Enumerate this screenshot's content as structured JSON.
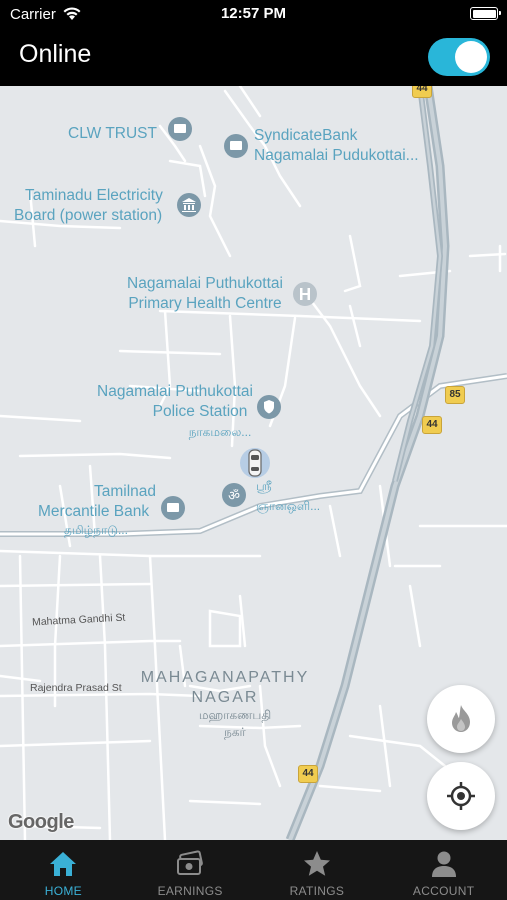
{
  "status_bar": {
    "carrier": "Carrier",
    "time": "12:57 PM"
  },
  "header": {
    "title": "Online",
    "online_toggle": true
  },
  "map": {
    "places": [
      {
        "name": "CLW TRUST"
      },
      {
        "name": "SyndicateBank",
        "sub": "Nagamalai Pudukottai..."
      },
      {
        "name": "Taminadu Electricity",
        "sub": "Board (power station)"
      },
      {
        "name": "Nagamalai Puthukottai",
        "sub": "Primary Health Centre"
      },
      {
        "name": "Nagamalai Puthukottai",
        "sub": "Police Station",
        "tamil": "நாகமலை..."
      },
      {
        "name": "Tamilnad",
        "sub": "Mercantile Bank",
        "tamil": "தமிழ்நாடு..."
      },
      {
        "tamil": "ஸ்ரீ",
        "tamil2": "ஞானஒளி..."
      }
    ],
    "streets": [
      "Mahatma Gandhi St",
      "Rajendra Prasad St"
    ],
    "area": {
      "name_line1": "MAHAGANAPATHY",
      "name_line2": "NAGAR",
      "tamil_line1": "மஹாகணபதி",
      "tamil_line2": "நகர்"
    },
    "highway_shields": [
      "44",
      "85",
      "44",
      "44"
    ],
    "attribution": "Google"
  },
  "fabs": {
    "surge": "flame-icon",
    "locate": "crosshair-icon"
  },
  "tabs": [
    {
      "label": "HOME",
      "icon": "home-icon",
      "active": true
    },
    {
      "label": "EARNINGS",
      "icon": "cash-icon",
      "active": false
    },
    {
      "label": "RATINGS",
      "icon": "star-icon",
      "active": false
    },
    {
      "label": "ACCOUNT",
      "icon": "person-icon",
      "active": false
    }
  ],
  "colors": {
    "accent": "#3ab0d6",
    "toggle": "#29b6d9",
    "map_bg": "#e4e7ea",
    "map_label": "#5aa3bf",
    "highway": "#a9b7c0"
  }
}
